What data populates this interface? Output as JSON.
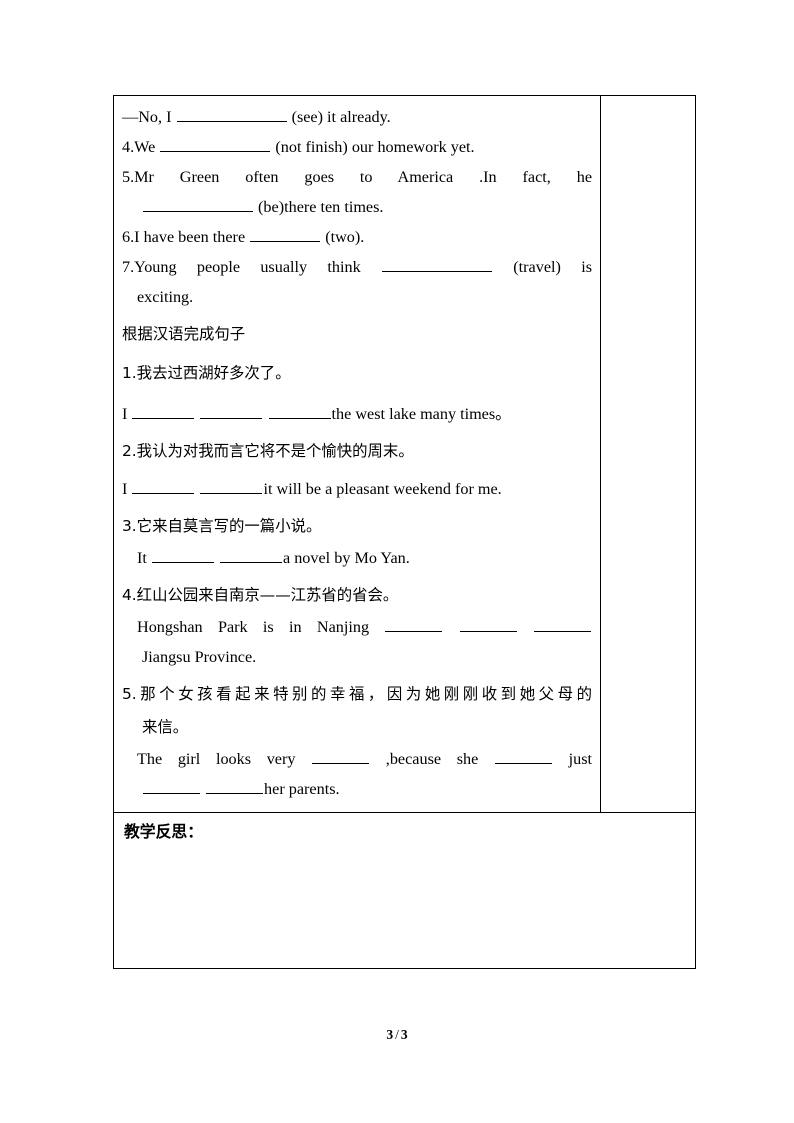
{
  "document": {
    "footer": {
      "current_page": "3",
      "separator": "/",
      "total_pages": "3"
    }
  },
  "worksheet": {
    "fill_in_blanks": {
      "items": [
        {
          "id": "item-3-answer",
          "prefix": "—No, I",
          "blank": "b-xl",
          "suffix": "(see) it already."
        },
        {
          "id": "item-4",
          "prefix": "4.We",
          "blank": "b-xl",
          "suffix": "(not finish) our homework yet."
        },
        {
          "id": "item-5",
          "line1": "5.Mr Green often goes to America .In fact, he",
          "line2_blank": "b-xl",
          "line2_suffix": "(be)there ten times."
        },
        {
          "id": "item-6",
          "prefix": "6.I have been there",
          "blank": "b-md",
          "suffix": "(two)."
        },
        {
          "id": "item-7",
          "line1_prefix": "7.Young people usually think",
          "line1_blank": "b-xl",
          "line1_suffix": "(travel) is",
          "line2": "exciting."
        }
      ]
    },
    "translation_section": {
      "heading": "根据汉语完成句子",
      "items": [
        {
          "id": "trans-1",
          "chinese": "1.我去过西湖好多次了。",
          "english_prefix": "I",
          "blanks": [
            "b-sm",
            "b-sm",
            "b-sm"
          ],
          "english_suffix": "the west lake many times。"
        },
        {
          "id": "trans-2",
          "chinese": "2.我认为对我而言它将不是个愉快的周末。",
          "english_prefix": "I",
          "blanks": [
            "b-sm",
            "b-sm"
          ],
          "english_suffix": "it will be a pleasant weekend for me."
        },
        {
          "id": "trans-3",
          "chinese": "3.它来自莫言写的一篇小说。",
          "english_prefix": "It",
          "blanks": [
            "b-sm",
            "b-sm"
          ],
          "english_suffix": "a novel by Mo Yan."
        },
        {
          "id": "trans-4",
          "chinese": "4.红山公园来自南京——江苏省的省会。",
          "english_line1_prefix": "Hongshan Park is in Nanjing",
          "english_line1_blanks": [
            "b-xs",
            "b-xs",
            "b-xs"
          ],
          "english_line2": "Jiangsu Province."
        },
        {
          "id": "trans-5",
          "chinese_line1": "5.那个女孩看起来特别的幸福，因为她刚刚收到她父母的",
          "chinese_line2": "来信。",
          "english_line1_prefix": "The girl looks very",
          "english_line1_mid": ",because she",
          "english_line1_suffix": "just",
          "english_line2_suffix": "her parents."
        }
      ]
    },
    "reflection": {
      "title": "教学反思：",
      "content": ""
    }
  }
}
